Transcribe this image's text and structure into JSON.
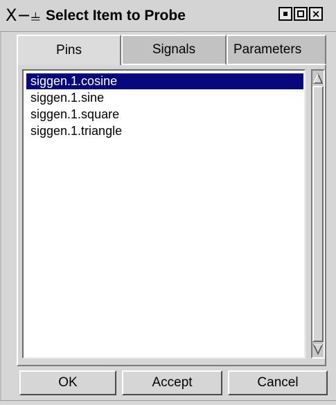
{
  "window": {
    "title": "Select Item to Probe",
    "system_menu_glyph": "X−⫨",
    "controls": {
      "minimize_icon": "minimize-icon",
      "maximize_icon": "maximize-icon",
      "close_icon": "close-icon"
    }
  },
  "tabs": [
    {
      "label": "Pins",
      "active": true
    },
    {
      "label": "Signals",
      "active": false
    },
    {
      "label": "Parameters",
      "active": false
    }
  ],
  "list": {
    "items": [
      {
        "label": "siggen.1.cosine",
        "selected": true
      },
      {
        "label": "siggen.1.sine",
        "selected": false
      },
      {
        "label": "siggen.1.square",
        "selected": false
      },
      {
        "label": "siggen.1.triangle",
        "selected": false
      }
    ]
  },
  "buttons": {
    "ok": "OK",
    "accept": "Accept",
    "cancel": "Cancel"
  },
  "colors": {
    "selection_background": "#08087e",
    "selection_text": "#ffffff",
    "window_background": "#d6d6d6"
  }
}
